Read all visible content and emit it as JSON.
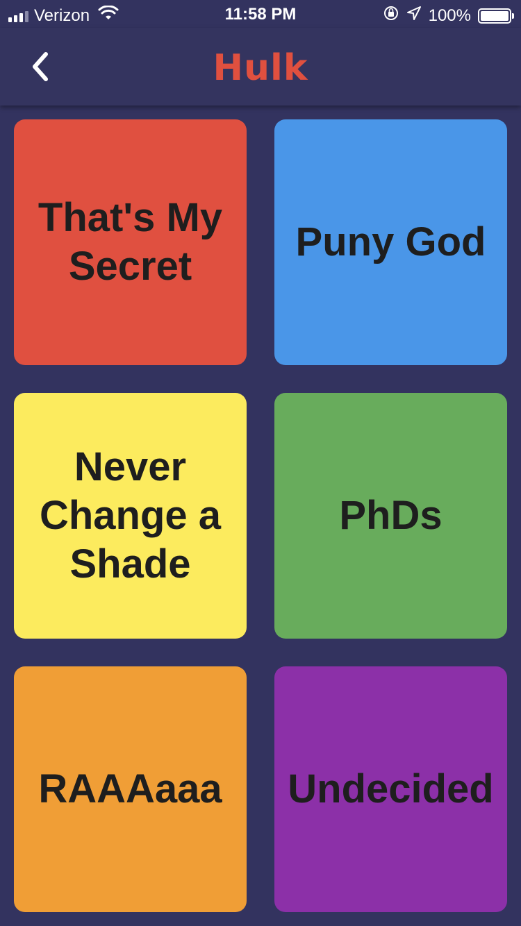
{
  "status_bar": {
    "carrier": "Verizon",
    "time": "11:58 PM",
    "battery": "100%",
    "icons": [
      "signal-icon",
      "wifi-icon",
      "orientation-lock-icon",
      "location-icon",
      "battery-icon"
    ]
  },
  "nav": {
    "title": "Hulk",
    "title_color": "#e0503f",
    "back_icon": "chevron-left-icon"
  },
  "tiles": [
    {
      "label": "That's My Secret",
      "color": "#e05040"
    },
    {
      "label": "Puny God",
      "color": "#4a96e8"
    },
    {
      "label": "Never Change a Shade",
      "color": "#fceb5e"
    },
    {
      "label": "PhDs",
      "color": "#68ac5c"
    },
    {
      "label": "RAAAaaa",
      "color": "#f09e36"
    },
    {
      "label": "Undecided",
      "color": "#8c30a8"
    }
  ]
}
